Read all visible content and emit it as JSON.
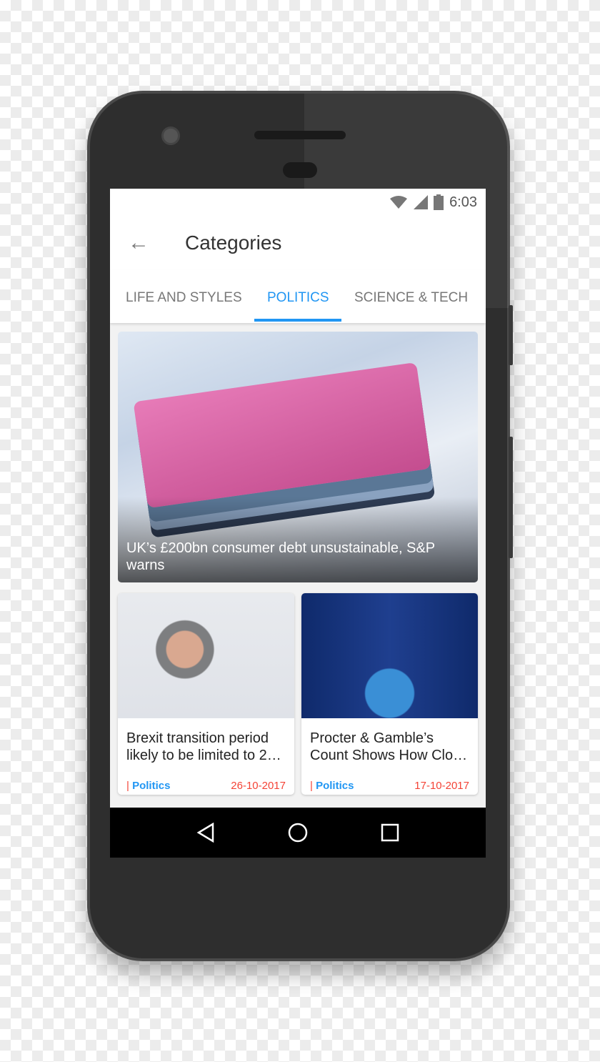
{
  "status": {
    "time": "6:03",
    "icons": [
      "wifi-icon",
      "signal-icon",
      "battery-icon"
    ]
  },
  "appbar": {
    "title": "Categories",
    "back_icon": "arrow-left-icon"
  },
  "tabs": [
    {
      "label": "LIFE AND STYLES"
    },
    {
      "label": "POLITICS",
      "active": true
    },
    {
      "label": "SCIENCE & TECH"
    }
  ],
  "hero": {
    "title": "UK’s £200bn consumer debt unsustainable, S&P warns"
  },
  "cards": [
    {
      "title": "Brexit transition period likely to be limited to 2…",
      "category": "Politics",
      "date": "26-10-2017"
    },
    {
      "title": "Procter & Gamble’s Count Shows How Clo…",
      "category": "Politics",
      "date": "17-10-2017"
    }
  ],
  "category_separator": "|",
  "colors": {
    "accent": "#2196f3",
    "date": "#f44336"
  },
  "navbar": {
    "icons": [
      "back-triangle-icon",
      "home-circle-icon",
      "recents-square-icon"
    ]
  }
}
